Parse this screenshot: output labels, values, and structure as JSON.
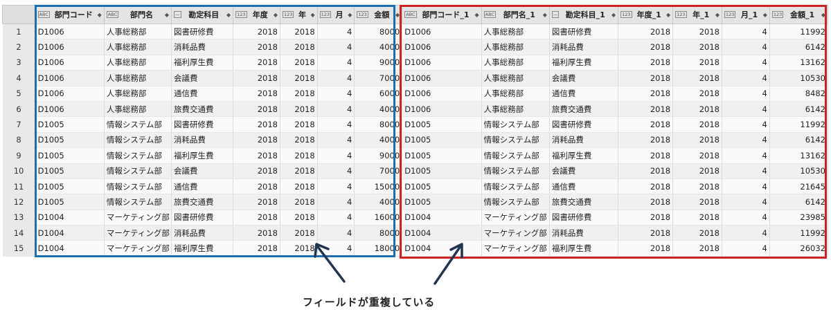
{
  "columns": [
    {
      "type": "ABC",
      "label": "部門コード",
      "align": "left"
    },
    {
      "type": "ABC",
      "label": "部門名",
      "align": "left"
    },
    {
      "type": "date",
      "label": "勘定科目",
      "align": "left"
    },
    {
      "type": "123",
      "label": "年度",
      "align": "right"
    },
    {
      "type": "123",
      "label": "年",
      "align": "right"
    },
    {
      "type": "123",
      "label": "月",
      "align": "right"
    },
    {
      "type": "123",
      "label": "金額",
      "align": "right"
    },
    {
      "type": "ABC",
      "label": "部門コード_1",
      "align": "left"
    },
    {
      "type": "ABC",
      "label": "部門名_1",
      "align": "left"
    },
    {
      "type": "date",
      "label": "勘定科目_1",
      "align": "left"
    },
    {
      "type": "123",
      "label": "年度_1",
      "align": "right"
    },
    {
      "type": "123",
      "label": "年_1",
      "align": "right"
    },
    {
      "type": "123",
      "label": "月_1",
      "align": "right"
    },
    {
      "type": "123",
      "label": "金額_1",
      "align": "right"
    }
  ],
  "rows": [
    [
      "1",
      "D1006",
      "人事総務部",
      "図書研修費",
      "2018",
      "2018",
      "4",
      "8000",
      "D1006",
      "人事総務部",
      "図書研修費",
      "2018",
      "2018",
      "4",
      "11992"
    ],
    [
      "2",
      "D1006",
      "人事総務部",
      "消耗品費",
      "2018",
      "2018",
      "4",
      "4000",
      "D1006",
      "人事総務部",
      "消耗品費",
      "2018",
      "2018",
      "4",
      "6142"
    ],
    [
      "3",
      "D1006",
      "人事総務部",
      "福利厚生費",
      "2018",
      "2018",
      "4",
      "9000",
      "D1006",
      "人事総務部",
      "福利厚生費",
      "2018",
      "2018",
      "4",
      "13162"
    ],
    [
      "4",
      "D1006",
      "人事総務部",
      "会議費",
      "2018",
      "2018",
      "4",
      "7000",
      "D1006",
      "人事総務部",
      "会議費",
      "2018",
      "2018",
      "4",
      "10530"
    ],
    [
      "5",
      "D1006",
      "人事総務部",
      "通信費",
      "2018",
      "2018",
      "4",
      "6000",
      "D1006",
      "人事総務部",
      "通信費",
      "2018",
      "2018",
      "4",
      "8482"
    ],
    [
      "6",
      "D1006",
      "人事総務部",
      "旅費交通費",
      "2018",
      "2018",
      "4",
      "4000",
      "D1006",
      "人事総務部",
      "旅費交通費",
      "2018",
      "2018",
      "4",
      "6142"
    ],
    [
      "7",
      "D1005",
      "情報システム部",
      "図書研修費",
      "2018",
      "2018",
      "4",
      "8000",
      "D1005",
      "情報システム部",
      "図書研修費",
      "2018",
      "2018",
      "4",
      "11992"
    ],
    [
      "8",
      "D1005",
      "情報システム部",
      "消耗品費",
      "2018",
      "2018",
      "4",
      "4000",
      "D1005",
      "情報システム部",
      "消耗品費",
      "2018",
      "2018",
      "4",
      "6142"
    ],
    [
      "9",
      "D1005",
      "情報システム部",
      "福利厚生費",
      "2018",
      "2018",
      "4",
      "9000",
      "D1005",
      "情報システム部",
      "福利厚生費",
      "2018",
      "2018",
      "4",
      "13162"
    ],
    [
      "10",
      "D1005",
      "情報システム部",
      "会議費",
      "2018",
      "2018",
      "4",
      "7000",
      "D1005",
      "情報システム部",
      "会議費",
      "2018",
      "2018",
      "4",
      "10530"
    ],
    [
      "11",
      "D1005",
      "情報システム部",
      "通信費",
      "2018",
      "2018",
      "4",
      "15000",
      "D1005",
      "情報システム部",
      "通信費",
      "2018",
      "2018",
      "4",
      "21645"
    ],
    [
      "12",
      "D1005",
      "情報システム部",
      "旅費交通費",
      "2018",
      "2018",
      "4",
      "4000",
      "D1005",
      "情報システム部",
      "旅費交通費",
      "2018",
      "2018",
      "4",
      "6142"
    ],
    [
      "13",
      "D1004",
      "マーケティング部",
      "図書研修費",
      "2018",
      "2018",
      "4",
      "16000",
      "D1004",
      "マーケティング部",
      "図書研修費",
      "2018",
      "2018",
      "4",
      "23985"
    ],
    [
      "14",
      "D1004",
      "マーケティング部",
      "消耗品費",
      "2018",
      "2018",
      "4",
      "8000",
      "D1004",
      "マーケティング部",
      "消耗品費",
      "2018",
      "2018",
      "4",
      "11992"
    ],
    [
      "15",
      "D1004",
      "マーケティング部",
      "福利厚生費",
      "2018",
      "2018",
      "4",
      "18000",
      "D1004",
      "マーケティング部",
      "福利厚生費",
      "2018",
      "2018",
      "4",
      "26032"
    ]
  ],
  "annotation": {
    "caption": "フィールドが重複している",
    "left_box_color": "#1a6fb3",
    "right_box_color": "#cc2222",
    "arrow_color": "#1f3550"
  }
}
